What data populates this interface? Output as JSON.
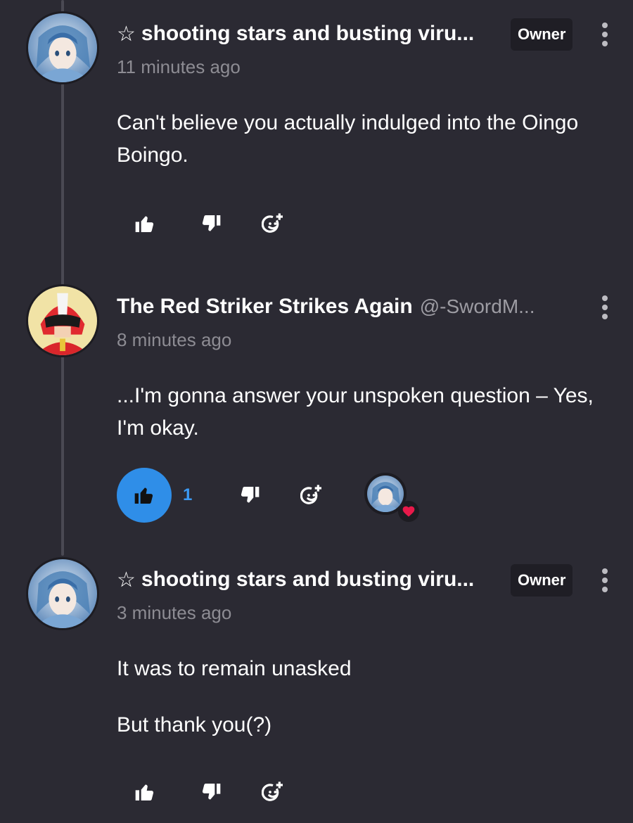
{
  "comments": [
    {
      "author": "shooting stars and busting viru...",
      "star": "☆",
      "badge": "Owner",
      "time": "11 minutes ago",
      "paragraphs": [
        "Can't believe you actually indulged into the Oingo Boingo."
      ],
      "avatar_icon": "anime-girl-avatar"
    },
    {
      "author": "The Red Striker Strikes Again",
      "handle": "@-SwordM...",
      "time": "8 minutes ago",
      "paragraphs": [
        "...I'm gonna answer your unspoken question – Yes, I'm okay."
      ],
      "like_count": "1",
      "liked": true,
      "reaction": "heart",
      "avatar_icon": "red-helmet-avatar"
    },
    {
      "author": "shooting stars and busting viru...",
      "star": "☆",
      "badge": "Owner",
      "time": "3 minutes ago",
      "paragraphs": [
        "It was to remain unasked",
        "But thank you(?)"
      ],
      "avatar_icon": "anime-girl-avatar"
    }
  ],
  "colors": {
    "background": "#2b2a33",
    "accent_like": "#2f8ee8",
    "heart": "#e8194a",
    "muted_text": "#8d8c93"
  },
  "icons": [
    "thumbs-up-icon",
    "thumbs-down-icon",
    "add-reaction-icon",
    "more-options-icon",
    "heart-icon",
    "star-icon"
  ]
}
